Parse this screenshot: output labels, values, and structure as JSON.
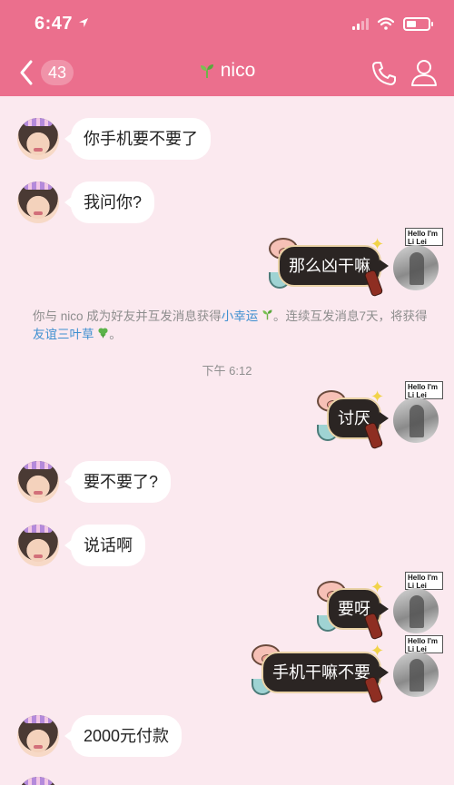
{
  "status_bar": {
    "time": "6:47"
  },
  "header": {
    "unread_count": "43",
    "contact_name": "nico"
  },
  "system_notice": {
    "before": "你与 nico 成为好友并互发消息获得",
    "link1": "小幸运",
    "middle": "。连续互发消息7天，将获得",
    "link2": "友谊三叶草",
    "after": "。"
  },
  "timestamp": "下午 6:12",
  "sticker_text": "Hello I'm Li Lei",
  "messages": [
    {
      "side": "left",
      "text": "你手机要不要了"
    },
    {
      "side": "left",
      "text": "我问你?"
    },
    {
      "side": "right",
      "text": "那么凶干嘛"
    },
    {
      "side": "right",
      "text": "讨厌"
    },
    {
      "side": "left",
      "text": "要不要了?"
    },
    {
      "side": "left",
      "text": "说话啊"
    },
    {
      "side": "right",
      "text": "要呀"
    },
    {
      "side": "right",
      "text": "手机干嘛不要"
    },
    {
      "side": "left",
      "text": "2000元付款"
    }
  ],
  "colors": {
    "header": "#eb6f8d",
    "background": "#fbe9ef",
    "link": "#3e8fd0"
  }
}
